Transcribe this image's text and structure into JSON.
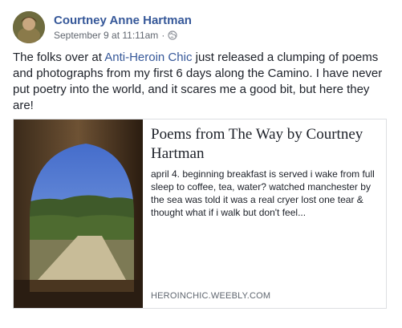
{
  "post": {
    "author": "Courtney Anne Hartman",
    "timestamp": "September 9 at 11:11am",
    "separator": "·",
    "privacy_icon": "globe-icon",
    "text_before": "The folks over at ",
    "text_link": "Anti-Heroin Chic",
    "text_after": " just released a clumping of poems and photographs from my first 6 days along the Camino. I have never put poetry into the world, and it scares me a good bit, but here they are!"
  },
  "link_card": {
    "title": "Poems from The Way by Courtney Hartman",
    "description": "april 4. beginning breakfast is served i wake from full sleep to coffee, tea, water? watched manchester by the sea was told it was a real cryer lost one tear & thought what if i walk but don't feel...",
    "domain": "HEROINCHIC.WEEBLY.COM"
  },
  "colors": {
    "link": "#365899",
    "text": "#1d2129",
    "meta": "#616770"
  }
}
